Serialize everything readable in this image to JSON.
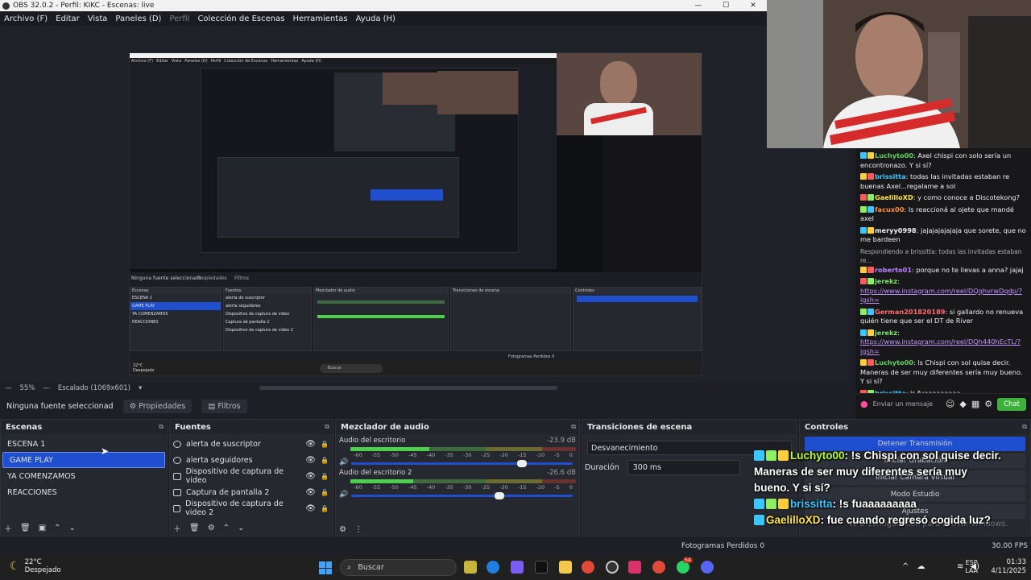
{
  "window": {
    "title": "OBS 32.0.2 - Perfil: KIKC - Escenas: live"
  },
  "menu": [
    "Archivo (F)",
    "Editar",
    "Vista",
    "Paneles (D)",
    "Perfil",
    "Colección de Escenas",
    "Herramientas",
    "Ayuda (H)"
  ],
  "preview": {
    "nested_menu": [
      "Archivo (F)",
      "Editar",
      "Vista",
      "Paneles (D)",
      "Perfil",
      "Colección de Escenas",
      "Herramientas",
      "Ayuda (H)"
    ],
    "nested_no_source": "Ninguna fuente seleccionada",
    "nested_props": "Propiedades",
    "nested_filters": "Filtros",
    "nested_scenes_title": "Escenas",
    "nested_sources_title": "Fuentes",
    "nested_mixer_title": "Mezclador de audio",
    "nested_trans_title": "Transiciones de escena",
    "nested_controls_title": "Controles",
    "nested_weather": "22°C",
    "nested_weather_desc": "Despejado",
    "nested_search": "Buscar",
    "nested_fps": "Fotogramas Perdidos 0"
  },
  "zoom": {
    "level": "55%",
    "scale": "Escalado (1069x601)"
  },
  "context": {
    "no_source": "Ninguna fuente seleccionad",
    "properties": "Propiedades",
    "filters": "Filtros"
  },
  "scenes": {
    "title": "Escenas",
    "items": [
      "ESCENA 1",
      "GAME PLAY",
      "YA COMENZAMOS",
      "REACCIONES"
    ],
    "selected": "GAME PLAY"
  },
  "sources": {
    "title": "Fuentes",
    "items": [
      "alerta de suscriptor",
      "alerta seguidores",
      "Dispositivo de captura de video",
      "Captura de pantalla 2",
      "Dispositivo de captura de video 2"
    ]
  },
  "mixer": {
    "title": "Mezclador de audio",
    "channels": [
      {
        "name": "Audio del escritorio",
        "db": "-23.9 dB",
        "level": 0.35,
        "volume": 0.77
      },
      {
        "name": "Audio del escritorio 2",
        "db": "-26.6 dB",
        "level": 0.28,
        "volume": 0.67
      }
    ],
    "ticks": [
      "-60",
      "-55",
      "-50",
      "-45",
      "-40",
      "-35",
      "-30",
      "-25",
      "-20",
      "-15",
      "-10",
      "-5",
      "0"
    ]
  },
  "transitions": {
    "title": "Transiciones de escena",
    "type": "Desvanecimiento",
    "duration_label": "Duración",
    "duration": "300 ms"
  },
  "controls": {
    "title": "Controles",
    "buttons": [
      "Detener Transmisión",
      "Iniciar Grabación",
      "Iniciar Cámara Virtual",
      "Modo Estudio",
      "Ajustes"
    ]
  },
  "overlay_chat": [
    {
      "user": "Luchyto00",
      "text": ": !s Chispi con sol quise decir. Maneras de ser muy diferentes sería muy bueno. Y si sí?"
    },
    {
      "user": "brissitta",
      "text": ": !s fuaaaaaaaaa"
    },
    {
      "user": "GaelilloXD",
      "text": ": fue cuando regresó cogida luz?"
    }
  ],
  "windows_watermark": "Ve a Configuración para activar Windows.",
  "chat": {
    "messages": [
      {
        "user": "Luchyto00",
        "color": "#5fd35f",
        "text": ": Axel chispi con solo sería un encontronazo. Y si sí?"
      },
      {
        "user": "brissitta",
        "color": "#3ac6ff",
        "text": ": todas las invitadas estaban re buenas Axel...regalame a sol"
      },
      {
        "user": "GaelilloXD",
        "color": "#ffe34a",
        "text": ": y como conoce a Discotekong?"
      },
      {
        "user": "facux00",
        "color": "#ff8c3a",
        "text": ": Is reaccioná al ojete que mandé axel"
      },
      {
        "user": "meryy0998",
        "color": "#efeff1",
        "text": ": jajajajajajaja que sorete, que no me bardeen"
      },
      {
        "user": "roberto01",
        "color": "#b983ff",
        "text": ": porque no te llevas a anna? jajaj",
        "reply": "Respondiendo a brissitta: todas las invitadas estaban re..."
      },
      {
        "user": "jerekz",
        "color": "#7ae36b",
        "text": ": ",
        "link": "https://www.instagram.com/reel/DQqhvrwDqdp/?igsh="
      },
      {
        "user": "German201820189",
        "color": "#ff6b6b",
        "text": ": si gallardo no renueva quién tiene que ser el DT de River"
      },
      {
        "user": "jerekz",
        "color": "#7ae36b",
        "text": ": ",
        "link": "https://www.instagram.com/reel/DQh440hEcTL/?igsh="
      },
      {
        "user": "Luchyto00",
        "color": "#5fd35f",
        "text": ": ls Chispi con sol quise decir. Maneras de ser muy diferentes sería muy bueno. Y si sí?"
      },
      {
        "user": "brissitta",
        "color": "#3ac6ff",
        "text": ": ls fuaaaaaaaaa"
      },
      {
        "user": "GaelilloXD",
        "color": "#ffe34a",
        "text": ": fue cuando regresó cogida luz?"
      }
    ],
    "input_placeholder": "Enviar un mensaje",
    "send_label": "Chat"
  },
  "status": {
    "dropped": "Fotogramas Perdidos 0",
    "fps": "30.00 FPS"
  },
  "taskbar": {
    "weather_temp": "22°C",
    "weather_desc": "Despejado",
    "search_placeholder": "Buscar",
    "lang": "ESP",
    "lang2": "LAA",
    "time": "01:33",
    "date": "4/11/2025",
    "badge": "54"
  },
  "colors": {
    "accent": "#1f4fcf",
    "twitch_send": "#3cb13c"
  }
}
